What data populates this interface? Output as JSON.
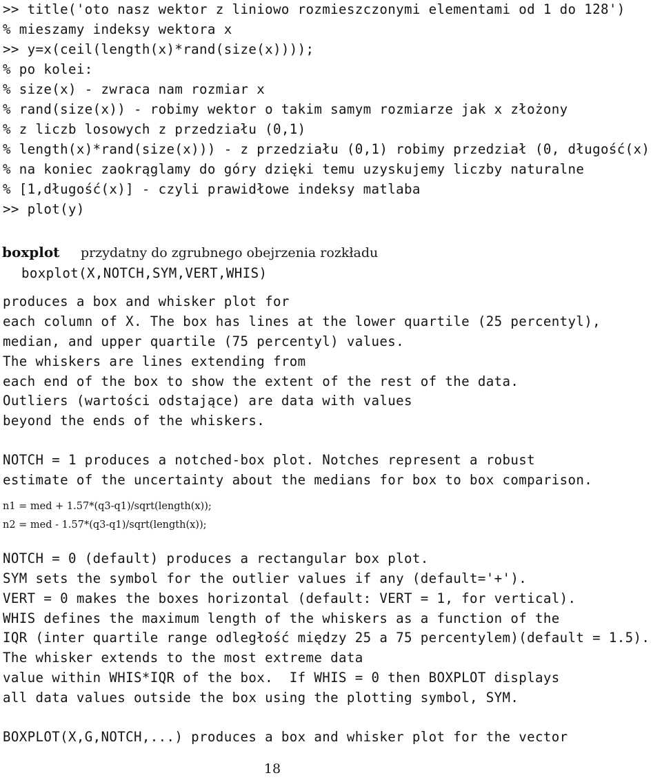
{
  "document": {
    "kind": "lecture-notes-page",
    "language": "pl-PL / en",
    "page_number": "18"
  },
  "session": {
    "lines": [
      ">> title('oto nasz wektor z liniowo rozmieszczonymi elementami od 1 do 128')",
      "% mieszamy indeksy wektora x",
      ">> y=x(ceil(length(x)*rand(size(x))));",
      "% po kolei:",
      "% size(x) - zwraca nam rozmiar x",
      "% rand(size(x)) - robimy wektor o takim samym rozmiarze jak x złożony",
      "% z liczb losowych z przedziału (0,1)",
      "% length(x)*rand(size(x))) - z przedziału (0,1) robimy przedział (0, długość(x)",
      "% na koniec zaokrąglamy do góry dzięki temu uzyskujemy liczby naturalne",
      "% [1,długość(x)] - czyli prawidłowe indeksy matlaba",
      ">> plot(y)"
    ]
  },
  "boxplot_section": {
    "heading": "boxplot",
    "description": "przydatny do zgrubnego obejrzenia rozkładu",
    "signature": "boxplot(X,NOTCH,SYM,VERT,WHIS)",
    "help_block_1": [
      "produces a box and whisker plot for",
      "each column of X. The box has lines at the lower quartile (25 percentyl),",
      "median, and upper quartile (75 percentyl) values.",
      "The whiskers are lines extending from",
      "each end of the box to show the extent of the rest of the data.",
      "Outliers (wartości odstające) are data with values",
      "beyond the ends of the whiskers."
    ],
    "notch_block": [
      "NOTCH = 1 produces a notched-box plot. Notches represent a robust",
      "estimate of the uncertainty about the medians for box to box comparison."
    ],
    "formulas": [
      "n1 = med + 1.57*(q3-q1)/sqrt(length(x));",
      "n2 = med - 1.57*(q3-q1)/sqrt(length(x));"
    ],
    "options_block": [
      "NOTCH = 0 (default) produces a rectangular box plot.",
      "SYM sets the symbol for the outlier values if any (default='+').",
      "VERT = 0 makes the boxes horizontal (default: VERT = 1, for vertical).",
      "WHIS defines the maximum length of the whiskers as a function of the",
      "IQR (inter quartile range odległość między 25 a 75 percentylem)(default = 1.5).",
      "The whisker extends to the most extreme data",
      "value within WHIS*IQR of the box.  If WHIS = 0 then BOXPLOT displays",
      "all data values outside the box using the plotting symbol, SYM."
    ],
    "grouped_block": [
      "BOXPLOT(X,G,NOTCH,...) produces a box and whisker plot for the vector"
    ]
  }
}
